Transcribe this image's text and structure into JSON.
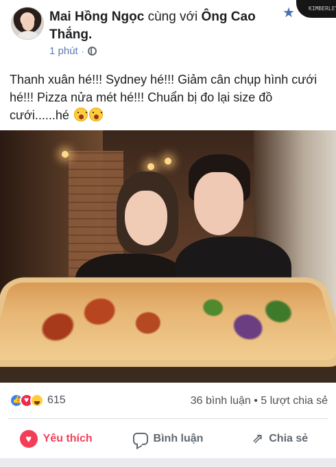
{
  "post": {
    "author": "Mai Hồng Ngọc",
    "with_text": "cùng với",
    "tagged": "Ông Cao Thắng.",
    "time": "1 phút",
    "privacy_dot": "·",
    "text": "Thanh xuân hé!!! Sydney hé!!! Giảm cân chụp hình cưới hé!!! Pizza nửa mét hé!!! Chuẩn bị đo lại size đồ cưới......hé"
  },
  "header": {
    "star_icon": "star-icon",
    "corner_thumbnail_sign": "KIMBERLEY"
  },
  "stats": {
    "reaction_count": "615",
    "comments_shares": "36 bình luận • 5 lượt chia sẻ"
  },
  "actions": {
    "like_label": "Yêu thích",
    "comment_label": "Bình luận",
    "share_label": "Chia sẻ"
  },
  "colors": {
    "love": "#f33e58",
    "link_meta": "#5b7bb5",
    "text": "#1c1e21",
    "muted": "#606770"
  },
  "icons": [
    "avatar",
    "globe-icon",
    "star-icon",
    "emoji-icon",
    "like-reaction-icon",
    "love-reaction-icon",
    "haha-reaction-icon",
    "heart-icon",
    "comment-icon",
    "share-icon"
  ]
}
